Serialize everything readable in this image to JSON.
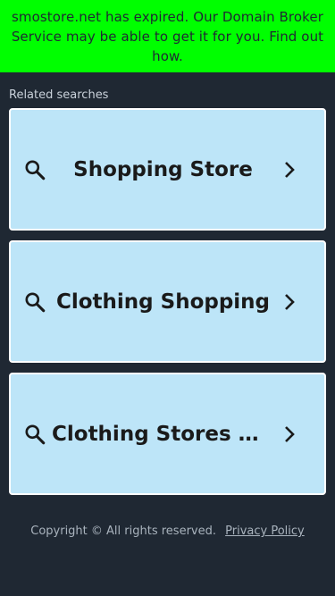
{
  "banner": {
    "text": "smostore.net has expired. Our Domain Broker Service may be able to get it for you. Find out how.",
    "background": "#00ff00"
  },
  "related": {
    "label": "Related searches",
    "items": [
      {
        "label": "Shopping Store"
      },
      {
        "label": "Clothing Shopping"
      },
      {
        "label": "Clothing Stores Near Me"
      }
    ]
  },
  "icons": {
    "search": "search-icon",
    "chevron": "chevron-right-icon"
  },
  "colors": {
    "page_bg": "#1f2833",
    "card_bg": "#bde5f8",
    "card_border": "#ffffff"
  },
  "footer": {
    "copyright": "Copyright ©  All rights reserved.",
    "privacy_link": "Privacy Policy"
  }
}
